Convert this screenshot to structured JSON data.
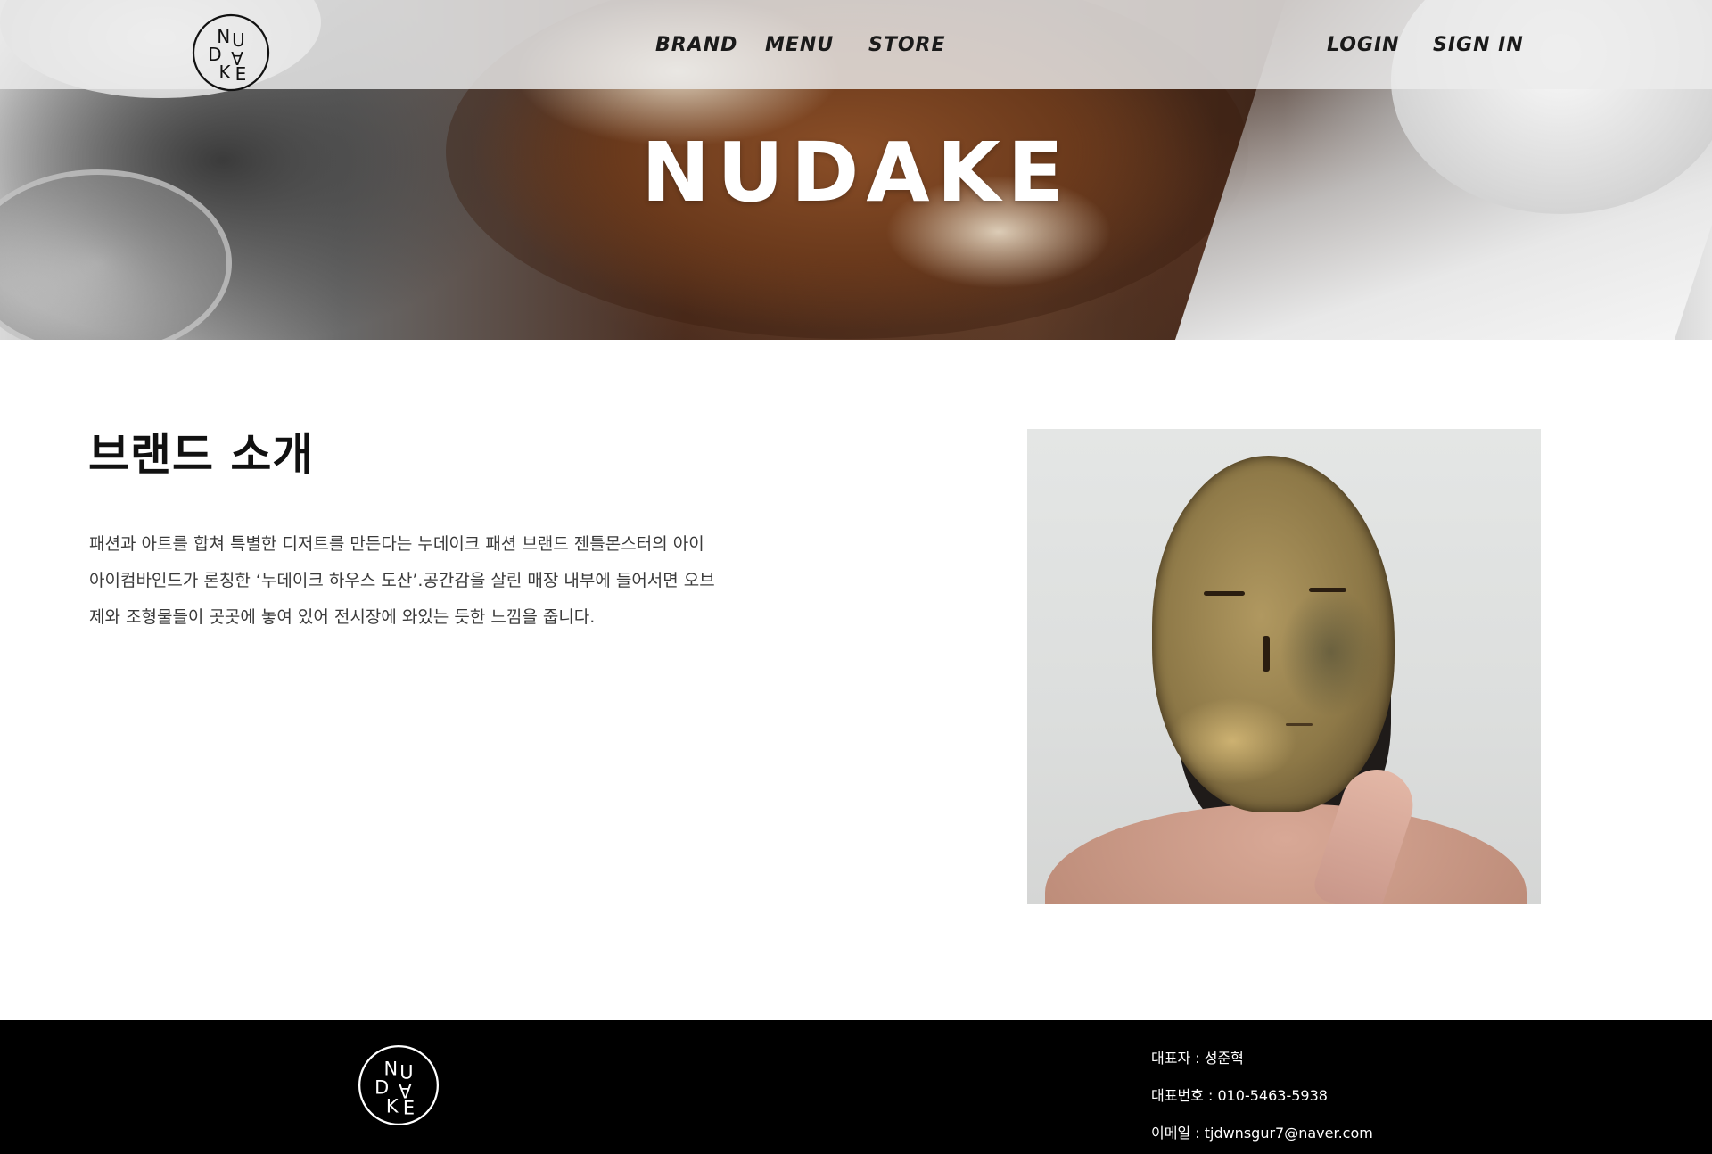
{
  "nav": {
    "logo_text": "NUDAKE",
    "links_left": [
      {
        "label": "BRAND",
        "name": "nav-link-brand"
      },
      {
        "label": "MENU",
        "name": "nav-link-menu"
      },
      {
        "label": "STORE",
        "name": "nav-link-store"
      }
    ],
    "links_right": [
      {
        "label": "LOGIN",
        "name": "nav-link-login"
      },
      {
        "label": "SIGN IN",
        "name": "nav-link-signin"
      }
    ]
  },
  "hero": {
    "title": "NUDAKE"
  },
  "brand": {
    "title": "브랜드 소개",
    "paragraph_lines": [
      "패션과 아트를 합쳐 특별한 디저트를 만든다는 누데이크 패션 브랜드 젠틀몬스터의 아이",
      "아이컴바인드가 론칭한 ‘누데이크 하우스 도산’.공간감을 살린 매장 내부에 들어서면 오브",
      "제와 조형물들이 곳곳에 놓여 있어 전시장에 와있는 듯한 느낌을 줍니다."
    ]
  },
  "footer": {
    "logo_text": "NUDAKE",
    "ceo": "대표자 : 성준혁",
    "phone": "대표번호 : 010-5463-5938",
    "email": "이메일 : tjdwnsgur7@naver.com"
  },
  "colors": {
    "nav_bg": "#ebebeb",
    "footer_bg": "#000000",
    "text_dark": "#111111",
    "text_body": "#3a3a3a",
    "hero_title": "#ffffff"
  }
}
